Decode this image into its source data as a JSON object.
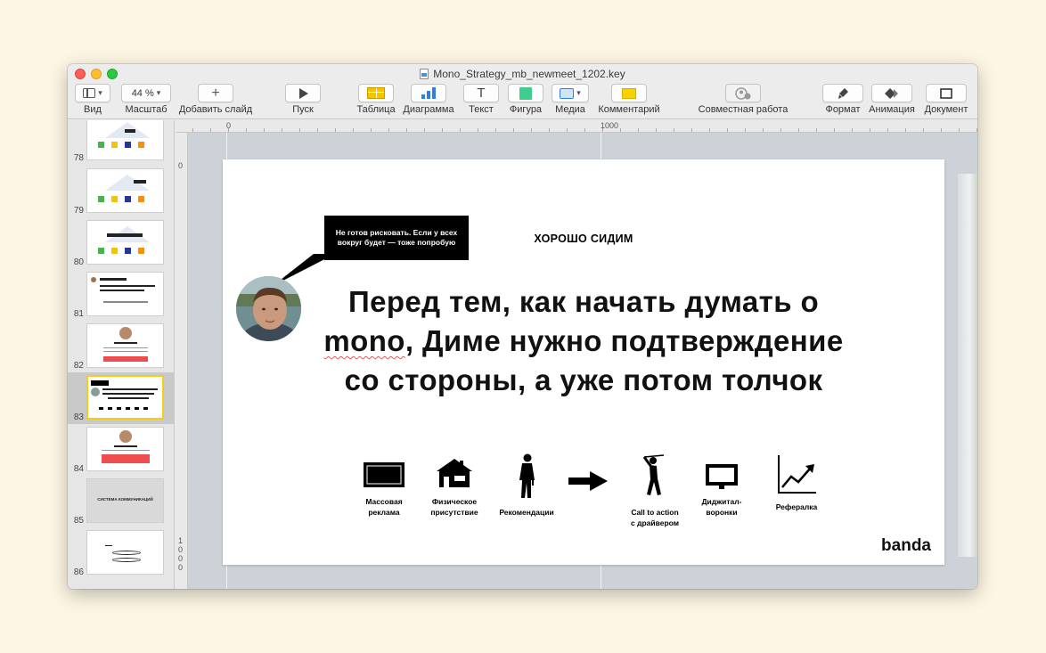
{
  "window": {
    "title": "Mono_Strategy_mb_newmeet_1202.key"
  },
  "toolbar": {
    "view_label": "Вид",
    "zoom_value": "44 %",
    "zoom_label": "Масштаб",
    "add_slide_label": "Добавить слайд",
    "play_label": "Пуск",
    "table_label": "Таблица",
    "chart_label": "Диаграмма",
    "text_label": "Текст",
    "shape_label": "Фигура",
    "media_label": "Медиа",
    "comment_label": "Комментарий",
    "collab_label": "Совместная работа",
    "format_label": "Формат",
    "animate_label": "Анимация",
    "document_label": "Документ"
  },
  "ruler": {
    "top_marks": [
      "0",
      "1000"
    ],
    "left_marks": [
      "0",
      "1",
      "0",
      "0",
      "0"
    ]
  },
  "slides": [
    {
      "number": "78"
    },
    {
      "number": "79"
    },
    {
      "number": "80"
    },
    {
      "number": "81"
    },
    {
      "number": "82"
    },
    {
      "number": "83",
      "selected": true
    },
    {
      "number": "84"
    },
    {
      "number": "85",
      "text": "СИСТЕМА КОММУНИКАЦИЙ"
    },
    {
      "number": "86"
    }
  ],
  "slide": {
    "heading": "ХОРОШО СИДИМ",
    "bubble_text": "Не готов рисковать. Если у всех вокруг будет — тоже попробую",
    "main_text_line1": "Перед тем, как начать думать о",
    "main_text_word_mono": "mono",
    "main_text_line2_rest": ", Диме нужно подтверждение",
    "main_text_line3": "со стороны, а уже потом толчок",
    "icons": [
      {
        "icon": "tv-icon",
        "line1": "Массовая",
        "line2": "реклама"
      },
      {
        "icon": "house-icon",
        "line1": "Физическое",
        "line2": "присутствие"
      },
      {
        "icon": "person-icon",
        "line1": "Рекомендации",
        "line2": ""
      },
      {
        "icon": "golfer-icon",
        "line1": "Call to action",
        "line2": "с драйвером"
      },
      {
        "icon": "monitor-icon",
        "line1": "Диджитал-",
        "line2": "воронки"
      },
      {
        "icon": "growth-chart-icon",
        "line1": "Рефералка",
        "line2": ""
      }
    ],
    "logo": "banda"
  }
}
